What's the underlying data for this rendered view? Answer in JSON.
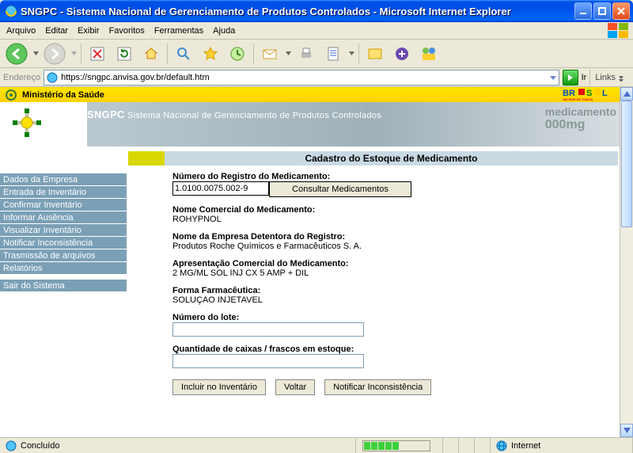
{
  "window": {
    "title": "SNGPC - Sistema Nacional de Gerenciamento de Produtos Controlados - Microsoft Internet Explorer"
  },
  "menu": {
    "arquivo": "Arquivo",
    "editar": "Editar",
    "exibir": "Exibir",
    "favoritos": "Favoritos",
    "ferramentas": "Ferramentas",
    "ajuda": "Ajuda"
  },
  "address": {
    "label": "Endereço",
    "url": "https://sngpc.anvisa.gov.br/default.htm",
    "go": "Ir",
    "links": "Links"
  },
  "ministry": {
    "text": "Ministério da Saúde"
  },
  "banner": {
    "acronym": "SNGPC",
    "full": "Sistema Nacional de Gerenciamento de Produtos Controlados",
    "med1": "medicamento",
    "med2": "000mg"
  },
  "sidebar": {
    "items": [
      {
        "label": "Dados da Empresa"
      },
      {
        "label": "Entrada de Inventário"
      },
      {
        "label": "Confirmar Inventário"
      },
      {
        "label": "Informar Ausência"
      },
      {
        "label": "Visualizar Inventário"
      },
      {
        "label": "Notificar Inconsistência"
      },
      {
        "label": "Trasmissão de arquivos"
      },
      {
        "label": "Relatórios"
      },
      {
        "label": "Sair do Sistema"
      }
    ]
  },
  "page": {
    "title": "Cadastro do Estoque de Medicamento",
    "registro_label": "Número do Registro do Medicamento:",
    "registro_value": "1.0100.0075.002-9",
    "consultar_btn": "Consultar Medicamentos",
    "nome_comercial_label": "Nome Comercial do Medicamento:",
    "nome_comercial_value": "ROHYPNOL",
    "empresa_label": "Nome da Empresa Detentora do Registro:",
    "empresa_value": "Produtos Roche Químicos e Farmacêuticos S. A.",
    "apresentacao_label": "Apresentação Comercial do Medicamento:",
    "apresentacao_value": "2 MG/ML SOL INJ CX 5 AMP + DIL",
    "forma_label": "Forma Farmacêutica:",
    "forma_value": "SOLUÇAO INJETAVEL",
    "lote_label": "Número do lote:",
    "qtd_label": "Quantidade de caixas / frascos em estoque:",
    "btn_incluir": "Incluir no Inventário",
    "btn_voltar": "Voltar",
    "btn_notificar": "Notificar Inconsistência"
  },
  "status": {
    "text": "Concluído",
    "zone": "Internet"
  }
}
